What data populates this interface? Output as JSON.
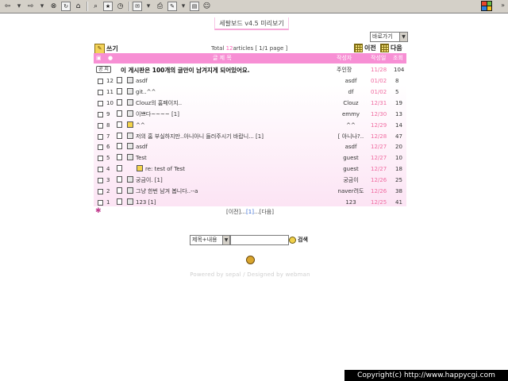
{
  "browser": {
    "toolbar_icons": [
      "back-icon",
      "back-dropdown-icon",
      "forward-icon",
      "forward-dropdown-icon",
      "stop-icon",
      "refresh-icon",
      "home-icon",
      "search-icon",
      "favorites-icon",
      "history-icon",
      "mail-icon",
      "print-icon",
      "edit-icon",
      "discuss-icon",
      "messenger-icon"
    ]
  },
  "board": {
    "title": "세팔보드 v4.5 미리보기",
    "jump_select": "바로가기",
    "write_label": "쓰기",
    "total_prefix": "Total ",
    "total_count": "12",
    "total_suffix": "articles [ 1/1 page ]",
    "prev_label": "이전",
    "next_label": "다음",
    "columns": {
      "title": "글 제 목",
      "author": "작성자",
      "date": "작성일",
      "views": "조회"
    },
    "notice": {
      "badge": "공 지",
      "title": "이 게시판은 100개의 글만이 남겨지게 되어있어요.",
      "author": "주인장",
      "date": "11/28",
      "views": "104"
    },
    "rows": [
      {
        "no": "12",
        "title": "asdf",
        "author": "asdf",
        "date": "01/02",
        "views": "8",
        "icon": "doc",
        "indent": 0
      },
      {
        "no": "11",
        "title": "git..^^",
        "author": "df",
        "date": "01/02",
        "views": "5",
        "icon": "doc",
        "indent": 0
      },
      {
        "no": "10",
        "title": "Clouz의 홈페이지..",
        "author": "Clouz",
        "date": "12/31",
        "views": "19",
        "icon": "doc",
        "indent": 0
      },
      {
        "no": "9",
        "title": "이쁘다~~~~ [1]",
        "author": "emmy",
        "date": "12/30",
        "views": "13",
        "icon": "doc",
        "indent": 0
      },
      {
        "no": "8",
        "title": "^^",
        "author": "^^",
        "date": "12/29",
        "views": "14",
        "icon": "img",
        "indent": 0
      },
      {
        "no": "7",
        "title": "저의 홈 부실하지만..아니아니 들러주시기 바랍니... [1]",
        "author": "[ 아니나?..",
        "date": "12/28",
        "views": "47",
        "icon": "doc",
        "indent": 0
      },
      {
        "no": "6",
        "title": "asdf",
        "author": "asdf",
        "date": "12/27",
        "views": "20",
        "icon": "doc",
        "indent": 0
      },
      {
        "no": "5",
        "title": "Test",
        "author": "guest",
        "date": "12/27",
        "views": "10",
        "icon": "doc",
        "indent": 0
      },
      {
        "no": "4",
        "title": "re: test of Test",
        "author": "guest",
        "date": "12/27",
        "views": "18",
        "icon": "reply",
        "indent": 1
      },
      {
        "no": "3",
        "title": "궁금이. [1]",
        "author": "궁금이",
        "date": "12/26",
        "views": "25",
        "icon": "doc",
        "indent": 0
      },
      {
        "no": "2",
        "title": "그냥 한번 남겨 봅니다..--a",
        "author": "naver려도",
        "date": "12/26",
        "views": "38",
        "icon": "doc",
        "indent": 0
      },
      {
        "no": "1",
        "title": "123 [1]",
        "author": "123",
        "date": "12/25",
        "views": "41",
        "icon": "doc",
        "indent": 0
      }
    ],
    "pager_prev": "[이전]...",
    "pager_current": "[1]",
    "pager_next": "...[다음]"
  },
  "search": {
    "select_value": "제목+내용",
    "input_value": "",
    "button_label": "검색"
  },
  "footer": {
    "powered": "Powered by sepal / Designed by webman",
    "copyright": "Copyright(c) http://www.happycgi.com"
  },
  "colors": {
    "header_bg": "#f78fd4",
    "accent_pink": "#ff5cb8",
    "date_text": "#f06aa0"
  }
}
